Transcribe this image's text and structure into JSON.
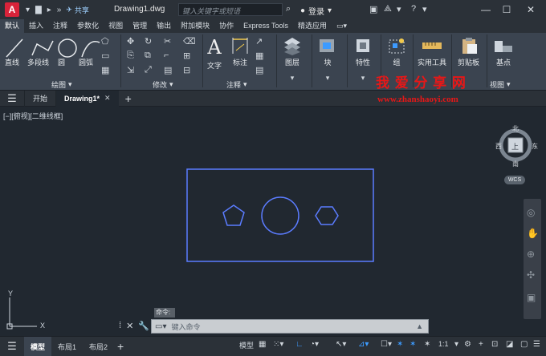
{
  "titlebar": {
    "logo": "A",
    "share_label": "共享",
    "document_title": "Drawing1.dwg",
    "search_placeholder": "键入关键字或短语",
    "login_label": "登录"
  },
  "ribbon_tabs": [
    "默认",
    "插入",
    "注释",
    "参数化",
    "视图",
    "管理",
    "输出",
    "附加模块",
    "协作",
    "Express Tools",
    "精选应用"
  ],
  "ribbon": {
    "draw_tools": [
      "直线",
      "多段线",
      "圆",
      "圆弧"
    ],
    "draw_panel": "绘图",
    "modify_panel": "修改",
    "text_label": "文字",
    "dimension_label": "标注",
    "annotation_panel": "注释",
    "layers_label": "图层",
    "block_label": "块",
    "properties_label": "特性",
    "group_label": "组",
    "utilities_label": "实用工具",
    "clipboard_label": "剪贴板",
    "base_label": "基点",
    "view_panel": "视图"
  },
  "watermark": {
    "title": "我 爱 分 享 网",
    "url": "www.zhanshaoyi.com"
  },
  "doc_tabs": {
    "start": "开始",
    "active": "Drawing1*"
  },
  "canvas": {
    "view_label": "[−][俯视][二维线框]",
    "viewcube": {
      "north": "北",
      "south": "南",
      "east": "东",
      "west": "西",
      "top": "上",
      "wcs": "WCS"
    },
    "ucs_x": "X",
    "ucs_y": "Y"
  },
  "command": {
    "prompt_label": "命令:",
    "input_placeholder": "键入命令"
  },
  "status": {
    "model_tab": "模型",
    "layout1": "布局1",
    "layout2": "布局2",
    "model_button": "模型",
    "scale": "1:1"
  },
  "colors": {
    "accent": "#3d9bff",
    "logo_red": "#d8233a",
    "canvas_bg": "#212830",
    "ribbon_bg": "#3b4450",
    "geometry": "#5b7cff"
  }
}
